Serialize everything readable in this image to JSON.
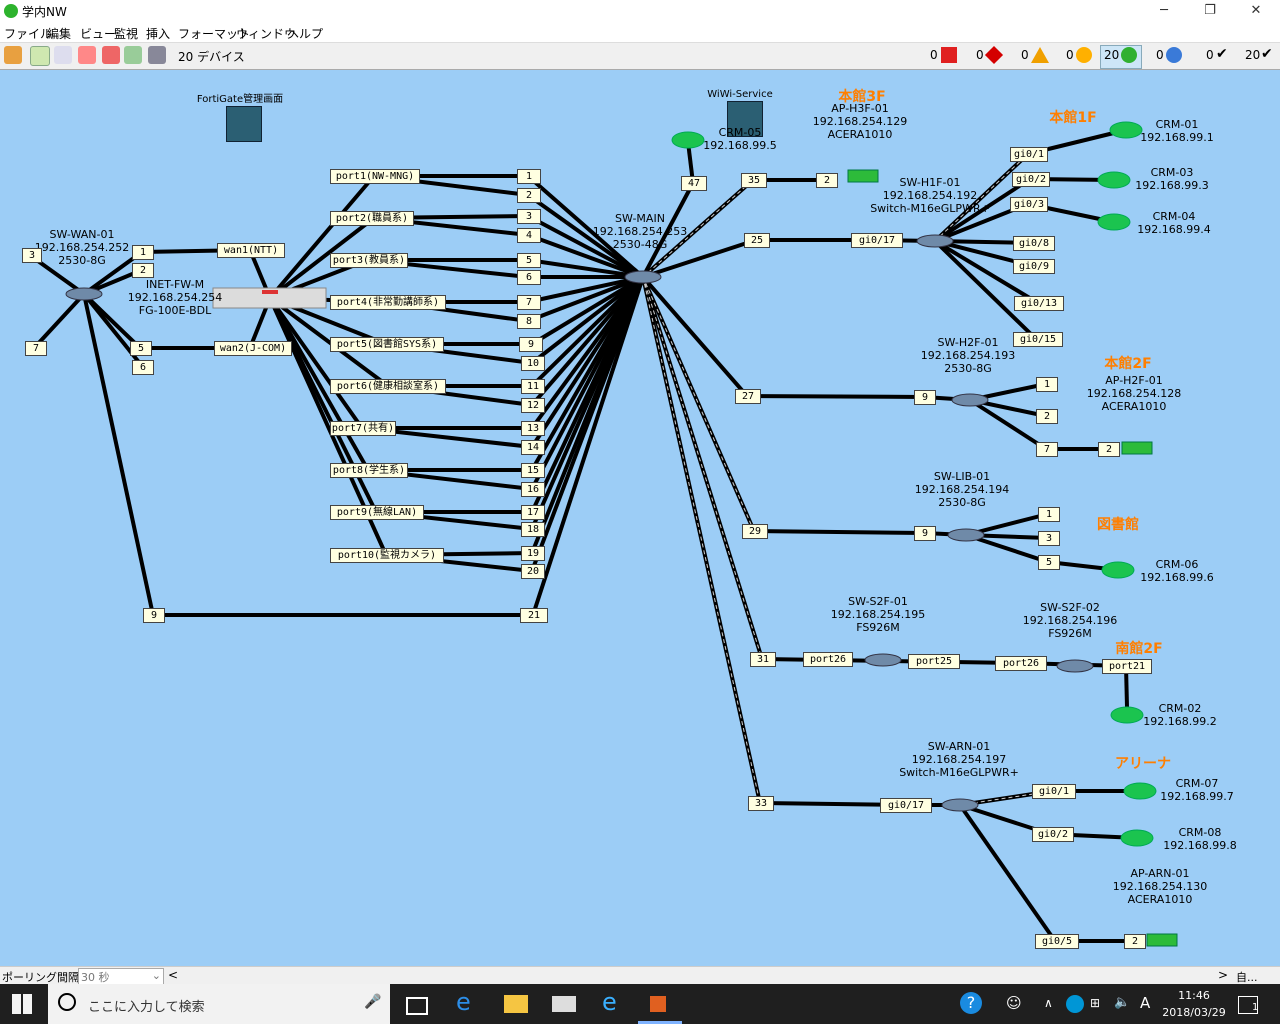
{
  "window": {
    "title": "学内NW",
    "minimize": "─",
    "restore": "❐",
    "close": "✕"
  },
  "menu": [
    "ファイル",
    "編集",
    "ビュー",
    "監視",
    "挿入",
    "フォーマット",
    "ウィンドウ",
    "ヘルプ"
  ],
  "toolbar": {
    "device_count": "20 デバイス",
    "status": [
      {
        "count": "0",
        "icon": "red-square-icon",
        "color": "#e02020"
      },
      {
        "count": "0",
        "icon": "red-diamond-icon",
        "color": "#d40000"
      },
      {
        "count": "0",
        "icon": "warning-triangle-icon",
        "color": "#f0a000"
      },
      {
        "count": "0",
        "icon": "orange-circle-icon",
        "color": "#ffb000"
      },
      {
        "count": "20",
        "icon": "green-circle-icon",
        "color": "#30b030"
      },
      {
        "count": "0",
        "icon": "question-icon",
        "color": "#3a7ad8"
      },
      {
        "count": "0",
        "icon": "check-icon",
        "color": "#333333"
      },
      {
        "count": "20",
        "icon": "check-icon",
        "color": "#333333"
      }
    ]
  },
  "map": {
    "locations": {
      "honkan3f": "本館3F",
      "honkan1f": "本館1F",
      "honkan2f": "本館2F",
      "library": "図書館",
      "minami2f": "南館2F",
      "arena": "アリーナ"
    },
    "fortigate_mgmt": "FortiGate管理画面",
    "wiwi_service": "WiWi-Service",
    "devices": {
      "sw_wan": [
        "SW-WAN-01",
        "192.168.254.252",
        "2530-8G"
      ],
      "fw": [
        "INET-FW-M",
        "192.168.254.254",
        "FG-100E-BDL"
      ],
      "sw_main": [
        "SW-MAIN",
        "192.168.254.253",
        "2530-48G"
      ],
      "crm05": [
        "CRM-05",
        "192.168.99.5"
      ],
      "ap_h3f": [
        "AP-H3F-01",
        "192.168.254.129",
        "ACERA1010"
      ],
      "sw_h1f": [
        "SW-H1F-01",
        "192.168.254.192",
        "Switch-M16eGLPWR+"
      ],
      "crm01": [
        "CRM-01",
        "192.168.99.1"
      ],
      "crm03": [
        "CRM-03",
        "192.168.99.3"
      ],
      "crm04": [
        "CRM-04",
        "192.168.99.4"
      ],
      "sw_h2f": [
        "SW-H2F-01",
        "192.168.254.193",
        "2530-8G"
      ],
      "ap_h2f": [
        "AP-H2F-01",
        "192.168.254.128",
        "ACERA1010"
      ],
      "sw_lib": [
        "SW-LIB-01",
        "192.168.254.194",
        "2530-8G"
      ],
      "crm06": [
        "CRM-06",
        "192.168.99.6"
      ],
      "sw_s2f1": [
        "SW-S2F-01",
        "192.168.254.195",
        "FS926M"
      ],
      "sw_s2f2": [
        "SW-S2F-02",
        "192.168.254.196",
        "FS926M"
      ],
      "crm02": [
        "CRM-02",
        "192.168.99.2"
      ],
      "sw_arn": [
        "SW-ARN-01",
        "192.168.254.197",
        "Switch-M16eGLPWR+"
      ],
      "crm07": [
        "CRM-07",
        "192.168.99.7"
      ],
      "crm08": [
        "CRM-08",
        "192.168.99.8"
      ],
      "ap_arn": [
        "AP-ARN-01",
        "192.168.254.130",
        "ACERA1010"
      ]
    },
    "ports": {
      "wan_l3": "3",
      "wan_l7": "7",
      "wan_1": "1",
      "wan_2": "2",
      "wan_5": "5",
      "wan_6": "6",
      "wan_9": "9",
      "fw_wan1": "wan1(NTT)",
      "fw_wan2": "wan2(J-COM)",
      "p1": "port1(NW-MNG)",
      "p2": "port2(職員系)",
      "p3": "port3(教員系)",
      "p4": "port4(非常勤講師系)",
      "p5": "port5(図書館SYS系)",
      "p6": "port6(健康相談室系)",
      "p7": "port7(共有)",
      "p8": "port8(学生系)",
      "p9": "port9(無線LAN)",
      "p10": "port10(監視カメラ)",
      "m1": "1",
      "m2": "2",
      "m3": "3",
      "m4": "4",
      "m5": "5",
      "m6": "6",
      "m7": "7",
      "m8": "8",
      "m9": "9",
      "m10": "10",
      "m11": "11",
      "m12": "12",
      "m13": "13",
      "m14": "14",
      "m15": "15",
      "m16": "16",
      "m17": "17",
      "m18": "18",
      "m19": "19",
      "m20": "20",
      "m21": "21",
      "m47": "47",
      "m35": "35",
      "m25": "25",
      "m27": "27",
      "m29": "29",
      "m31": "31",
      "m33": "33",
      "h3f_2": "2",
      "h1f_17": "gi0/17",
      "h1f_1": "gi0/1",
      "h1f_2": "gi0/2",
      "h1f_3": "gi0/3",
      "h1f_8": "gi0/8",
      "h1f_9": "gi0/9",
      "h1f_13": "gi0/13",
      "h1f_15": "gi0/15",
      "h2f_9": "9",
      "h2f_1": "1",
      "h2f_2": "2",
      "h2f_7": "7",
      "aph2f_2": "2",
      "lib_9": "9",
      "lib_1": "1",
      "lib_3": "3",
      "lib_5": "5",
      "s2f1_26": "port26",
      "s2f1_25": "port25",
      "s2f2_26": "port26",
      "s2f2_21": "port21",
      "arn_17": "gi0/17",
      "arn_1": "gi0/1",
      "arn_2": "gi0/2",
      "arn_5": "gi0/5",
      "aparn_2": "2"
    }
  },
  "statusbar": {
    "label": "ポーリング間隔:",
    "value": "30 秒",
    "right": "自..."
  },
  "taskbar": {
    "search_placeholder": "ここに入力して検索",
    "time": "11:46",
    "date": "2018/03/29",
    "notif_count": "1",
    "ime": "A"
  }
}
